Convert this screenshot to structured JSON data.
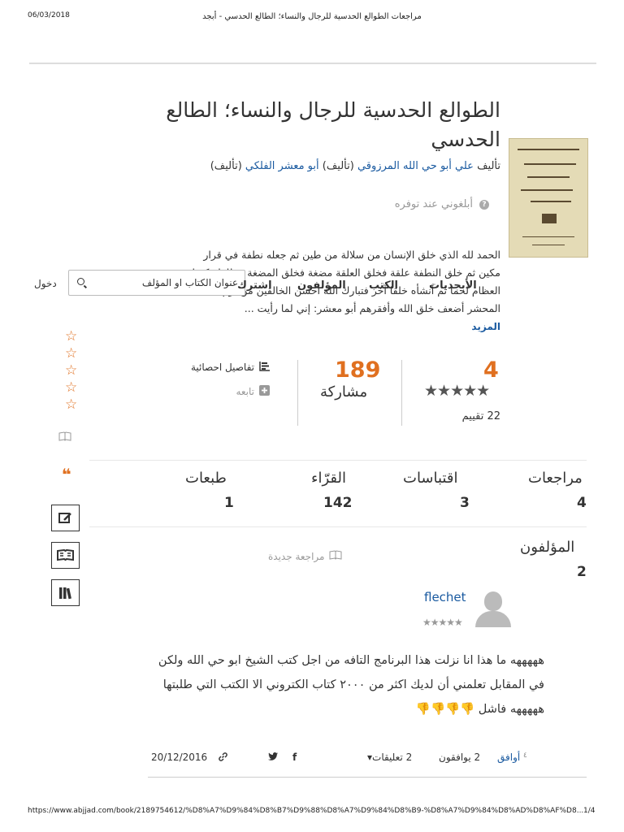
{
  "print_header": {
    "date": "06/03/2018",
    "title": "مراجعات الطوالع الحدسية للرجال والنساء؛ الطالع الحدسي - أبجد"
  },
  "book": {
    "title": "الطوالع الحدسية للرجال والنساء؛ الطالع الحدسي",
    "authors_prefix": "تأليف",
    "author1": "علي أبو حي الله المرزوقي",
    "author1_role": "(تأليف)",
    "author2": "أبو معشر الفلكي",
    "author2_role": "(تأليف)",
    "notify_label": "أبلغوني عند توفره",
    "description": "الحمد لله الذي خلق الإنسان من سلالة من طين ثم جعله نطفة في قرار مكين ثم خلق النطفة علقة فخلق العلقة مضغة فخلق المضغة عظاما فكسا العظام لحما ثم أنشأه خلقا آخر فتبارك الله أحسن الخالقين من يوم المحشر أضعف خلق الله وأفقرهم أبو معشر: إني لما رأيت ...",
    "more_label": "المزيد"
  },
  "nav": {
    "login": "دخول",
    "search_placeholder": "عنوان الكتاب او المؤلف",
    "items": [
      "اشترك",
      "المؤلفون",
      "الكتب",
      "الأبجديات"
    ]
  },
  "rating": {
    "value": "4",
    "stars": "★★★★★",
    "count_label": "22 تقييم"
  },
  "shares": {
    "value": "189",
    "label": "مشاركة"
  },
  "links": {
    "stats": "تفاصيل احصائية",
    "follow": "تابعه",
    "new_review": "مراجعة جديدة"
  },
  "side": {
    "stars": [
      "☆",
      "☆",
      "☆",
      "☆",
      "☆"
    ],
    "quote": "❝"
  },
  "stats": [
    {
      "label": "مراجعات",
      "value": "4"
    },
    {
      "label": "اقتباسات",
      "value": "3"
    },
    {
      "label": "القرّاء",
      "value": "142"
    },
    {
      "label": "طبعات",
      "value": "1"
    }
  ],
  "authors_count": {
    "label": "المؤلفون",
    "value": "2"
  },
  "review": {
    "reviewer": "flechet",
    "stars": "★★★★★",
    "text": "هههههه ما هذا انا نزلت هذا البرنامج التافه من اجل كتب الشيخ ابو حي الله ولكن في المقابل تعلمني أن لديك اكثر من ٢٠٠٠ كتاب الكتروني الا الكتب التي طلبتها هههههه فاشل",
    "emoji": "👎👎👎👎",
    "agree_label": "أوافق",
    "agree_count": "2 يوافقون",
    "comments": "2 تعليقات",
    "date": "20/12/2016"
  },
  "print_footer": {
    "url": "https://www.abjjad.com/book/2189754612/%D8%A7%D9%84%D8%B7%D9%88%D8%A7%D9%84%D8%B9-%D8%A7%D9%84%D8%AD%D8%AF%D8...",
    "page": "1/4"
  }
}
